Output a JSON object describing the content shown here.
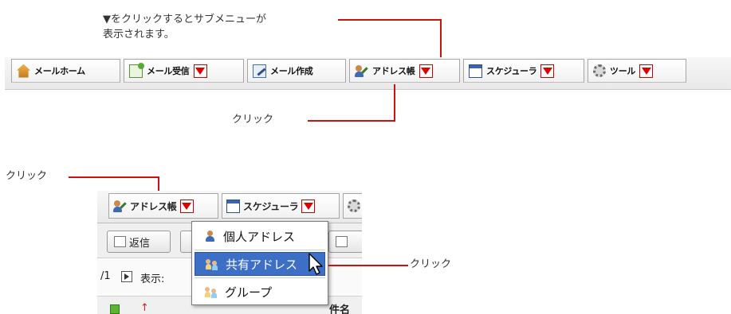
{
  "annotations": {
    "submenu_note_line1": "▼をクリックするとサブメニューが",
    "submenu_note_line2": "表示されます。",
    "click_label_a": "クリック",
    "click_label_b": "クリック",
    "click_label_c": "クリック"
  },
  "tabs": [
    {
      "label": "メールホーム",
      "icon": "home-icon",
      "dropdown": false
    },
    {
      "label": "メール受信",
      "icon": "mail-receive-icon",
      "dropdown": true
    },
    {
      "label": "メール作成",
      "icon": "mail-compose-icon",
      "dropdown": false
    },
    {
      "label": "アドレス帳",
      "icon": "address-book-icon",
      "dropdown": true
    },
    {
      "label": "スケジューラ",
      "icon": "scheduler-icon",
      "dropdown": true
    },
    {
      "label": "ツール",
      "icon": "tools-icon",
      "dropdown": true
    }
  ],
  "zoom": {
    "tabs": [
      {
        "label": "アドレス帳",
        "icon": "address-book-icon"
      },
      {
        "label": "スケジューラ",
        "icon": "scheduler-icon"
      }
    ],
    "reply_button": "返信",
    "page_indicator": "/1",
    "display_label": "表示:",
    "column_subject": "件名",
    "submenu": [
      {
        "label": "個人アドレス",
        "icon": "personal-address-icon",
        "selected": false
      },
      {
        "label": "共有アドレス",
        "icon": "shared-address-icon",
        "selected": true
      },
      {
        "label": "グループ",
        "icon": "group-icon",
        "selected": false
      }
    ]
  },
  "colors": {
    "annotation_line": "#cc1111",
    "dropdown_arrow": "#dd0000",
    "menu_highlight": "#3e6fc7"
  }
}
